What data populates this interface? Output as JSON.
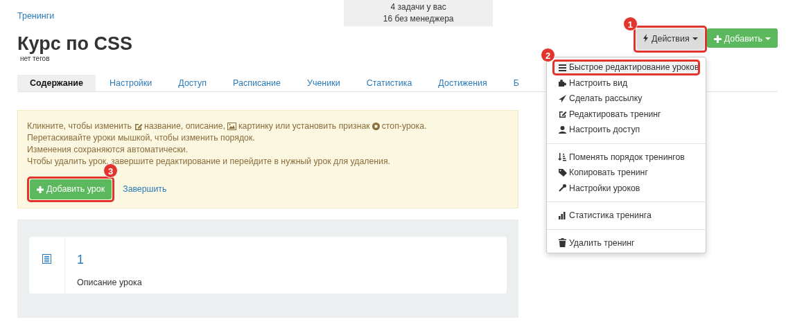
{
  "breadcrumb": "Тренинги",
  "task_box": [
    "4 задачи у вас",
    "16 без менеджера"
  ],
  "title": "Курс по CSS",
  "tags": "нет тегов",
  "actions_button": {
    "label": "Действия",
    "marker": "1"
  },
  "add_button": {
    "label": "Добавить"
  },
  "tabs": [
    {
      "label": "Содержание",
      "selected": true
    },
    {
      "label": "Настройки",
      "selected": false
    },
    {
      "label": "Доступ",
      "selected": false
    },
    {
      "label": "Расписание",
      "selected": false
    },
    {
      "label": "Ученики",
      "selected": false
    },
    {
      "label": "Статистика",
      "selected": false
    },
    {
      "label": "Достижения",
      "selected": false
    },
    {
      "label": "Б",
      "selected": false
    }
  ],
  "hint": {
    "lines": [
      {
        "parts": [
          {
            "kind": "text",
            "text": "Кликните, чтобы изменить"
          },
          {
            "kind": "edit"
          },
          {
            "kind": "text",
            "text": "название, описание,"
          },
          {
            "kind": "image"
          },
          {
            "kind": "text",
            "text": "картинку или установить признак"
          },
          {
            "kind": "stop"
          },
          {
            "kind": "text",
            "text": "стоп-урока."
          }
        ]
      },
      {
        "parts": [
          {
            "kind": "text",
            "text": "Перетаскивайте уроки мышкой, чтобы изменить порядок."
          }
        ]
      },
      {
        "parts": [
          {
            "kind": "text",
            "text": "Изменения сохраняются автоматически."
          }
        ]
      },
      {
        "parts": [
          {
            "kind": "text",
            "text": "Чтобы удалить урок, завершите редактирование и перейдите в нужный урок для удаления."
          }
        ]
      }
    ],
    "add_lesson_button": {
      "label": "Добавить урок",
      "marker": "3"
    },
    "finish_link": "Завершить"
  },
  "lessons": [
    {
      "number": "1",
      "description": "Описание урока"
    }
  ],
  "menu": {
    "groups": [
      [
        {
          "kind": "list",
          "label": "Быстрое редактирование уроков",
          "selected": true,
          "marker": "2"
        },
        {
          "kind": "puzzle",
          "label": "Настроить вид",
          "selected": false
        },
        {
          "kind": "send",
          "label": "Сделать рассылку",
          "selected": false
        },
        {
          "kind": "edit",
          "label": "Редактировать тренинг",
          "selected": false
        },
        {
          "kind": "user",
          "label": "Настроить доступ",
          "selected": false
        }
      ],
      [
        {
          "kind": "sort",
          "label": "Поменять порядок тренингов",
          "selected": false
        },
        {
          "kind": "tags",
          "label": "Копировать тренинг",
          "selected": false
        },
        {
          "kind": "wrench",
          "label": "Настройки уроков",
          "selected": false
        }
      ],
      [
        {
          "kind": "chart",
          "label": "Статистика тренинга",
          "selected": false
        }
      ],
      [
        {
          "kind": "trash",
          "label": "Удалить тренинг",
          "selected": false
        }
      ]
    ]
  }
}
